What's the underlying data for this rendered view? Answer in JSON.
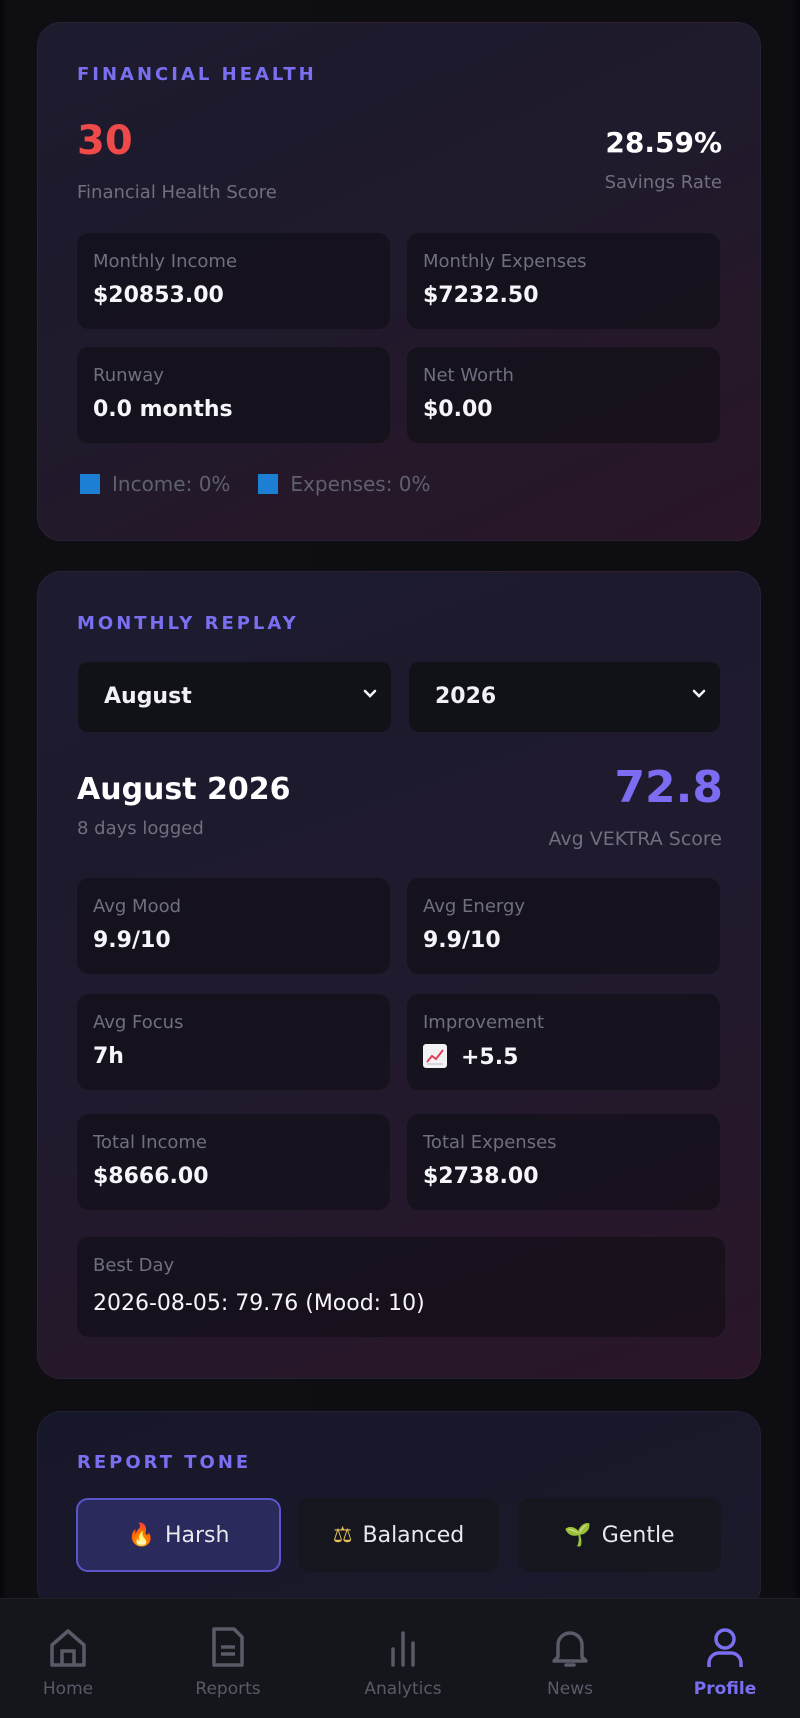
{
  "financial_health": {
    "title": "FINANCIAL HEALTH",
    "score": "30",
    "score_label": "Financial Health Score",
    "savings_rate": "28.59%",
    "savings_rate_label": "Savings Rate",
    "tiles": [
      {
        "label": "Monthly Income",
        "value": "$20853.00"
      },
      {
        "label": "Monthly Expenses",
        "value": "$7232.50"
      },
      {
        "label": "Runway",
        "value": "0.0 months"
      },
      {
        "label": "Net Worth",
        "value": "$0.00"
      }
    ],
    "legend": [
      {
        "label": "Income: 0%",
        "color": "#1c7fd4"
      },
      {
        "label": "Expenses: 0%",
        "color": "#1c7fd4"
      }
    ],
    "score_color": "#ef4a4a"
  },
  "monthly_replay": {
    "title": "MONTHLY REPLAY",
    "month_select": "August",
    "year_select": "2026",
    "period_title": "August 2026",
    "days_logged": "8 days logged",
    "avg_score": "72.8",
    "avg_score_label": "Avg VEKTRA Score",
    "tiles": [
      {
        "label": "Avg Mood",
        "value": "9.9/10"
      },
      {
        "label": "Avg Energy",
        "value": "9.9/10"
      },
      {
        "label": "Avg Focus",
        "value": "7h"
      },
      {
        "label": "Improvement",
        "value": "+5.5",
        "icon": "chart-increasing-icon"
      },
      {
        "label": "Total Income",
        "value": "$8666.00"
      },
      {
        "label": "Total Expenses",
        "value": "$2738.00"
      }
    ],
    "best_day": {
      "label": "Best Day",
      "value": "2026-08-05: 79.76 (Mood: 10)"
    },
    "accent": "#7b6cf2"
  },
  "report_tone": {
    "title": "REPORT TONE",
    "options": [
      {
        "label": "Harsh",
        "icon": "🔥",
        "active": true
      },
      {
        "label": "Balanced",
        "icon": "⚖",
        "active": false
      },
      {
        "label": "Gentle",
        "icon": "🌱",
        "active": false
      }
    ]
  },
  "nav": {
    "items": [
      {
        "label": "Home",
        "icon": "home-icon"
      },
      {
        "label": "Reports",
        "icon": "document-icon"
      },
      {
        "label": "Analytics",
        "icon": "bar-chart-icon"
      },
      {
        "label": "News",
        "icon": "bell-icon"
      },
      {
        "label": "Profile",
        "icon": "user-icon",
        "active": true
      }
    ]
  }
}
